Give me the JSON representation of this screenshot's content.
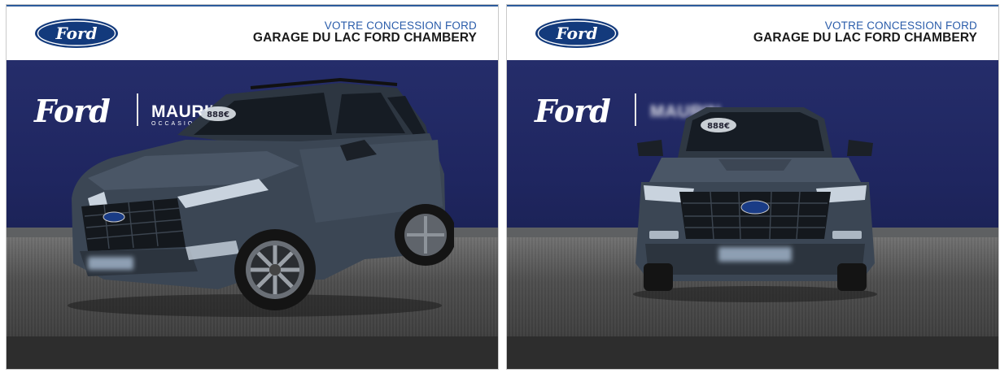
{
  "cards": [
    {
      "header_line1": "VOTRE CONCESSION FORD",
      "header_line2": "GARAGE DU LAC FORD CHAMBERY",
      "brand_script": "Ford",
      "brand_oval": "Ford",
      "partner_text": "MAURIN",
      "partner_sub": "OCCASIONS",
      "windshield_sticker": "888€",
      "view": "three-quarter front"
    },
    {
      "header_line1": "VOTRE CONCESSION FORD",
      "header_line2": "GARAGE DU LAC FORD CHAMBERY",
      "brand_script": "Ford",
      "brand_oval": "Ford",
      "partner_text": "MAURIN",
      "windshield_sticker": "888€",
      "view": "front"
    }
  ],
  "colors": {
    "ford_blue": "#133a7c",
    "wall": "#232a65",
    "header_accent": "#2a5caa",
    "car_body": "#3b4654"
  }
}
